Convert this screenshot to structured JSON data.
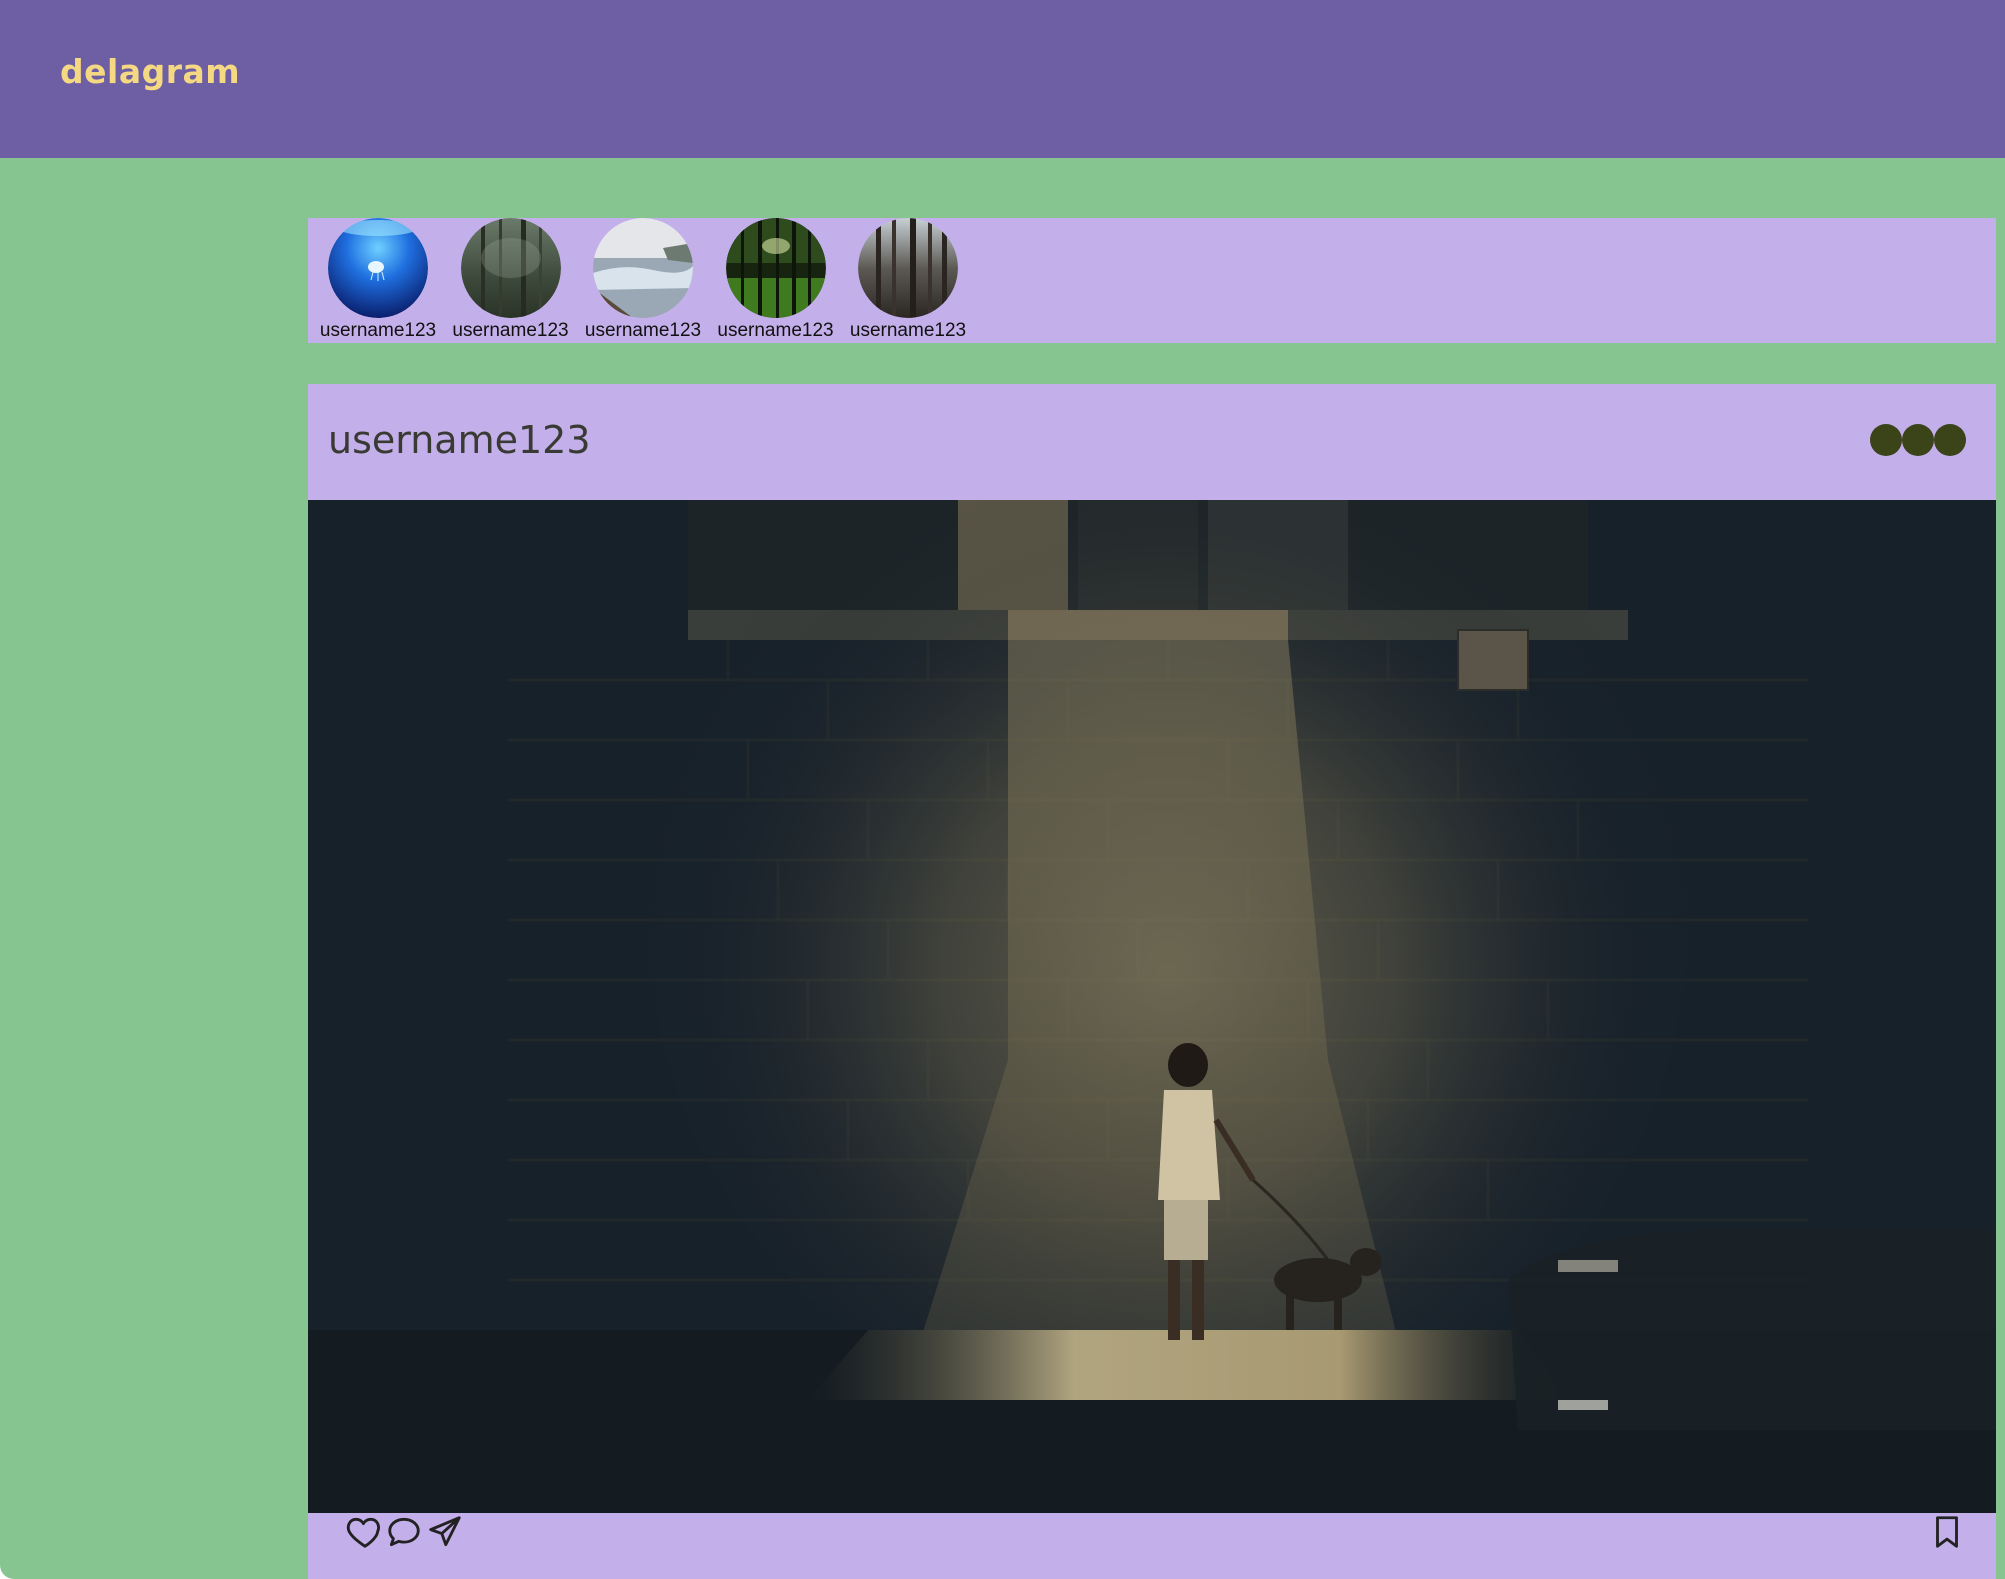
{
  "app": {
    "brand": "delagram",
    "colors": {
      "header_bg": "#6e5ea4",
      "page_bg": "#87c590",
      "card_bg": "#c3afe9",
      "brand_text": "#f4d882",
      "menu_dots": "#3b4419"
    }
  },
  "stories": [
    {
      "username": "username123",
      "image": "jellyfish-underwater"
    },
    {
      "username": "username123",
      "image": "misty-forest"
    },
    {
      "username": "username123",
      "image": "waterfall-river"
    },
    {
      "username": "username123",
      "image": "sunlit-forest"
    },
    {
      "username": "username123",
      "image": "tall-pine-trees"
    }
  ],
  "post": {
    "username": "username123",
    "image": "child-walking-dog-by-stone-wall-in-light-beam",
    "icons": {
      "more": "more-options-icon",
      "like": "heart-icon",
      "comment": "comment-icon",
      "share": "send-icon",
      "save": "bookmark-icon"
    }
  }
}
